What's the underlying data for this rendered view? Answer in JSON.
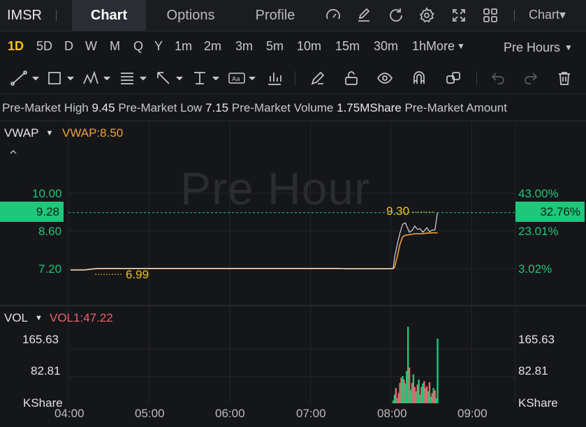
{
  "header": {
    "ticker": "IMSR",
    "tabs": [
      {
        "label": "Chart",
        "active": true
      },
      {
        "label": "Options",
        "active": false
      },
      {
        "label": "Profile",
        "active": false
      }
    ],
    "icons": [
      "speed-gauge-icon",
      "edit-icon",
      "refresh-icon",
      "settings-icon",
      "fullscreen-icon",
      "grid-layout-icon"
    ],
    "chart_menu": "Chart▾"
  },
  "intervals": {
    "items": [
      "1D",
      "5D",
      "D",
      "W",
      "M",
      "Q",
      "Y",
      "1m",
      "2m",
      "3m",
      "5m",
      "10m",
      "15m",
      "30m",
      "1h"
    ],
    "active": "1D",
    "more": "More",
    "session": "Pre Hours"
  },
  "toolbar": {
    "icons": [
      "trendline-tool-icon",
      "rectangle-tool-icon",
      "pattern-tool-icon",
      "fib-tool-icon",
      "arrow-tool-icon",
      "measure-tool-icon",
      "text-tool-icon",
      "indicator-tool-icon",
      "pen-icon",
      "unlock-icon",
      "eye-icon",
      "magnet-icon",
      "clone-icon",
      "undo-icon",
      "redo-icon",
      "trash-icon"
    ]
  },
  "stats": {
    "high_label": "Pre-Market High",
    "high": "9.45",
    "low_label": "Pre-Market Low",
    "low": "7.15",
    "volume_label": "Pre-Market Volume",
    "volume": "1.75MShare",
    "amount_label": "Pre-Market Amount"
  },
  "price_pane": {
    "indicator": "VWAP",
    "indicator_value": "VWAP:8.50",
    "watermark": "Pre Hour",
    "left_ticks": [
      "10.00",
      "8.60",
      "7.20"
    ],
    "right_ticks": [
      "43.00%",
      "23.01%",
      "3.02%"
    ],
    "current_price": "9.28",
    "current_pct": "32.76%",
    "high_marker": "9.30",
    "low_marker": "6.99"
  },
  "volume_pane": {
    "indicator": "VOL",
    "indicator_value": "VOL1:47.22",
    "ticks": [
      "165.63",
      "82.81"
    ],
    "unit": "KShare"
  },
  "time_axis": [
    "04:00",
    "05:00",
    "06:00",
    "07:00",
    "08:00",
    "09:00"
  ],
  "colors": {
    "up": "#1ec77a",
    "down": "#f0626b",
    "vwap": "#f0a13a",
    "price_line": "#e7e8ea",
    "accent": "#f5c518"
  },
  "chart_data": {
    "type": "line",
    "x": [
      "04:00",
      "04:05",
      "04:10",
      "04:20",
      "04:25",
      "04:40",
      "05:00",
      "06:00",
      "07:00",
      "07:20",
      "07:25",
      "07:40",
      "07:57",
      "08:00",
      "08:01",
      "08:03",
      "08:05",
      "08:07",
      "08:09",
      "08:12",
      "08:14",
      "08:16",
      "08:18",
      "08:20",
      "08:22",
      "08:25",
      "08:27",
      "08:29",
      "08:31",
      "08:33"
    ],
    "series": [
      {
        "name": "Price",
        "values": [
          7.15,
          7.15,
          7.15,
          7.21,
          7.21,
          7.21,
          7.21,
          7.21,
          7.21,
          7.21,
          7.19,
          7.19,
          7.19,
          7.21,
          7.62,
          8.1,
          8.52,
          8.85,
          8.9,
          8.55,
          8.62,
          8.78,
          8.66,
          8.68,
          8.55,
          8.72,
          8.57,
          8.63,
          8.64,
          9.3
        ]
      },
      {
        "name": "VWAP",
        "values": [
          7.15,
          7.15,
          7.15,
          7.2,
          7.2,
          7.2,
          7.2,
          7.2,
          7.2,
          7.2,
          7.2,
          7.2,
          7.2,
          7.2,
          7.25,
          7.65,
          8.1,
          8.38,
          8.44,
          8.46,
          8.48,
          8.5,
          8.5,
          8.5,
          8.5,
          8.52,
          8.52,
          8.53,
          8.53,
          8.53
        ]
      }
    ],
    "ylim": [
      6.6,
      11.0
    ],
    "volume": {
      "x": [
        "08:00",
        "08:01",
        "08:02",
        "08:03",
        "08:04",
        "08:05",
        "08:06",
        "08:07",
        "08:08",
        "08:09",
        "08:10",
        "08:11",
        "08:12",
        "08:13",
        "08:14",
        "08:15",
        "08:16",
        "08:17",
        "08:18",
        "08:19",
        "08:20",
        "08:21",
        "08:22",
        "08:23",
        "08:24",
        "08:25",
        "08:26",
        "08:27",
        "08:28",
        "08:29",
        "08:30",
        "08:31",
        "08:32",
        "08:33"
      ],
      "values": [
        8,
        25,
        45,
        15,
        30,
        60,
        75,
        80,
        70,
        58,
        95,
        225,
        105,
        40,
        60,
        85,
        48,
        35,
        55,
        70,
        25,
        48,
        58,
        65,
        45,
        50,
        35,
        62,
        20,
        30,
        45,
        38,
        15,
        190
      ],
      "up": [
        true,
        true,
        false,
        true,
        false,
        true,
        false,
        true,
        false,
        true,
        true,
        true,
        false,
        true,
        false,
        true,
        false,
        true,
        false,
        true,
        true,
        false,
        true,
        false,
        true,
        false,
        true,
        false,
        true,
        false,
        true,
        false,
        true,
        true
      ],
      "ylim": [
        0,
        240
      ]
    }
  }
}
